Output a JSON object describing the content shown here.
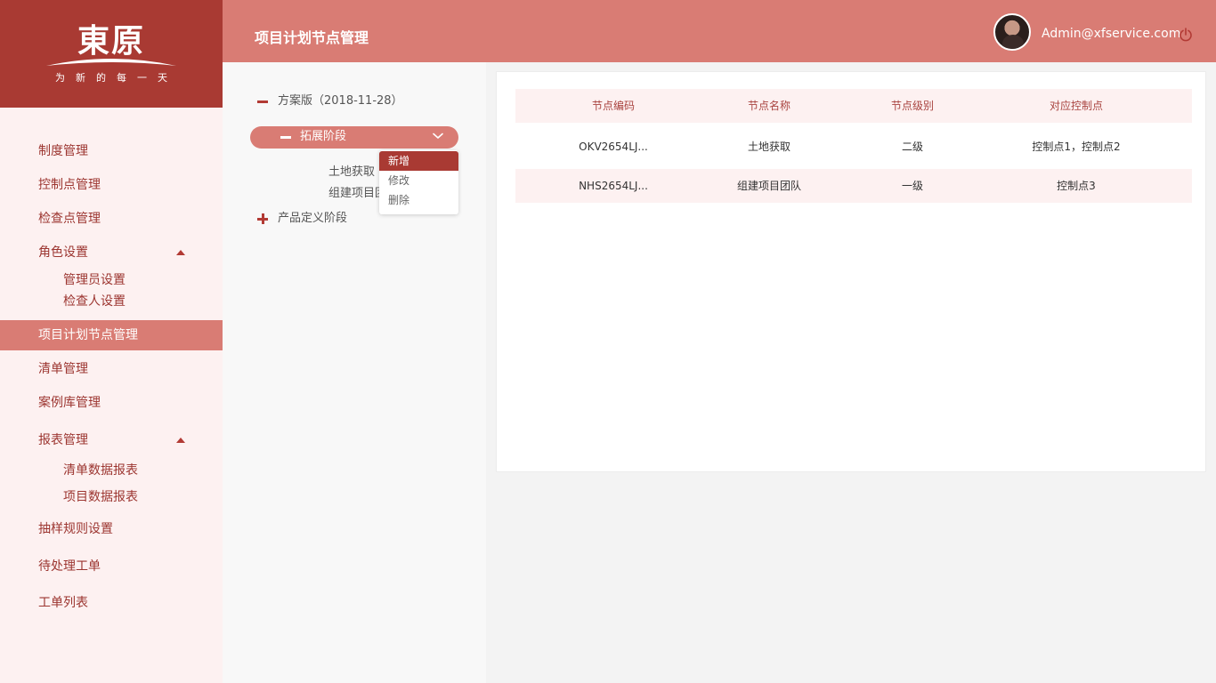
{
  "logo": {
    "main": "東原",
    "tagline": "为新的每一天"
  },
  "header": {
    "title": "项目计划节点管理",
    "user_email": "Admin@xfservice.com"
  },
  "sidebar": {
    "items": [
      {
        "label": "制度管理"
      },
      {
        "label": "控制点管理"
      },
      {
        "label": "检查点管理"
      },
      {
        "label": "角色设置",
        "children": [
          {
            "label": "管理员设置"
          },
          {
            "label": "检查人设置"
          }
        ]
      },
      {
        "label": "项目计划节点管理",
        "active": true
      },
      {
        "label": "清单管理"
      },
      {
        "label": "案例库管理"
      },
      {
        "label": "报表管理",
        "children": [
          {
            "label": "清单数据报表"
          },
          {
            "label": "项目数据报表"
          }
        ]
      },
      {
        "label": "抽样规则设置"
      },
      {
        "label": "待处理工单"
      },
      {
        "label": "工单列表"
      }
    ]
  },
  "tree": {
    "root": {
      "label": "方案版（2018-11-28）"
    },
    "stage_active": {
      "label": "拓展阶段",
      "children": [
        {
          "label": "土地获取"
        },
        {
          "label": "组建项目团队"
        }
      ]
    },
    "stage_2": {
      "label": "产品定义阶段"
    }
  },
  "context_menu": {
    "items": [
      {
        "label": "新增",
        "selected": true
      },
      {
        "label": "修改"
      },
      {
        "label": "删除"
      }
    ]
  },
  "table": {
    "columns": [
      "节点编码",
      "节点名称",
      "节点级别",
      "对应控制点"
    ],
    "rows": [
      [
        "OKV2654LJ...",
        "土地获取",
        "二级",
        "控制点1，控制点2"
      ],
      [
        "NHS2654LJ...",
        "组建项目团队",
        "一级",
        "控制点3"
      ]
    ]
  },
  "colors": {
    "brand_dark": "#a93a33",
    "brand": "#d97c74",
    "pale": "#fdf1f1"
  },
  "icons": {
    "header_power": "power-icon",
    "tree_collapse": "minus-icon",
    "tree_expand": "plus-icon",
    "stage_menu": "chevron-down-icon",
    "submenu_toggle": "caret-up-icon"
  }
}
